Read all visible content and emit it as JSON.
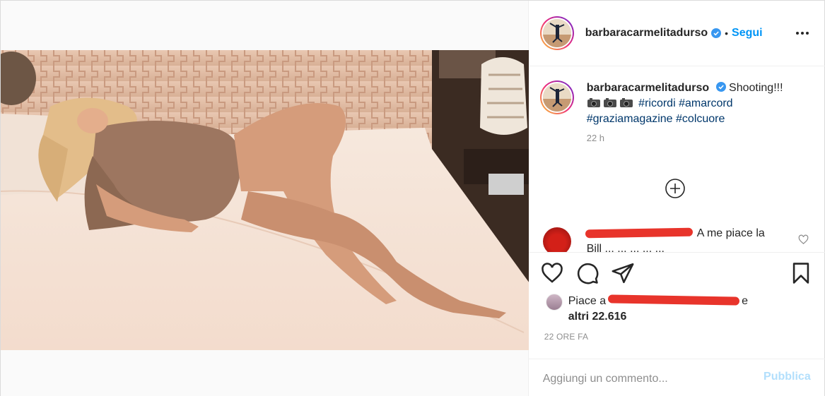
{
  "post": {
    "username": "barbaracarmelitadurso",
    "verified": true,
    "follow_label": "Segui",
    "separator": "•",
    "more_icon": "more-options-icon"
  },
  "caption": {
    "username": "barbaracarmelitadurso",
    "text": "Shooting!!!",
    "emoji": "camera-with-flash x3",
    "hashtags": [
      "#ricordi",
      "#amarcord",
      "#graziamagazine",
      "#colcuore"
    ],
    "time": "22 h"
  },
  "comment": {
    "text_line1": "A me piace la",
    "text_line2": "Bill ... ... ... ... ..."
  },
  "likes": {
    "prefix": "Piace a",
    "suffix": "e",
    "others": "altri 22.616"
  },
  "timestamp": "22 ORE FA",
  "add_comment": {
    "placeholder": "Aggiungi un commento...",
    "publish_label": "Pubblica"
  },
  "colors": {
    "accent": "#0095f6",
    "publish_disabled": "#b2dffc",
    "hashtag": "#00376b",
    "redaction": "#e8342b"
  }
}
